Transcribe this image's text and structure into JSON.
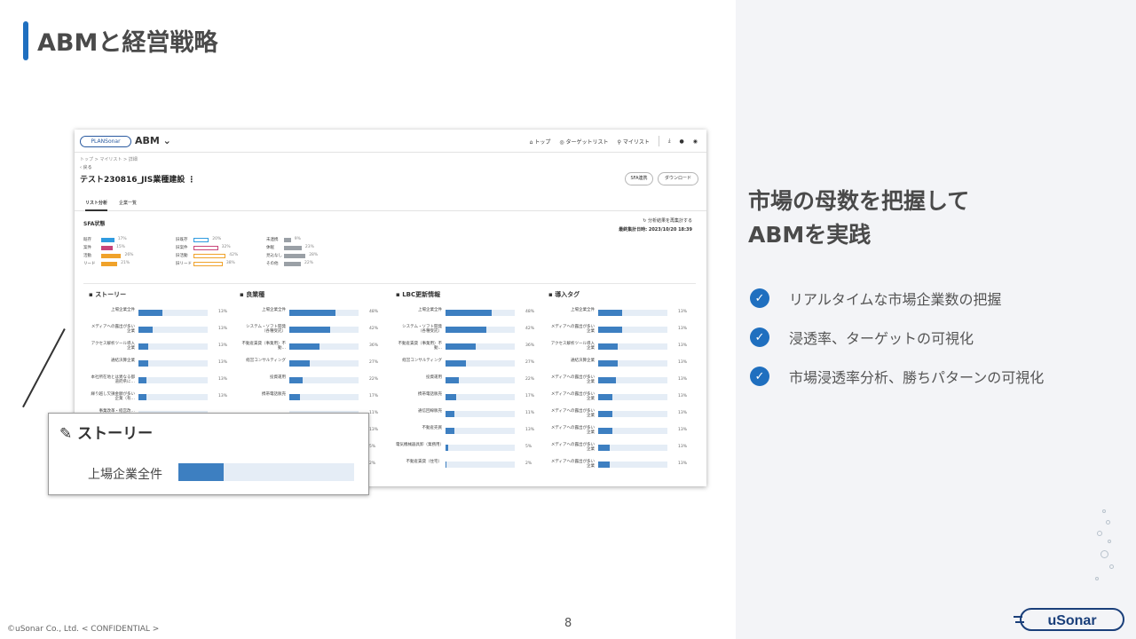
{
  "slide": {
    "title": "ABMと経営戦略",
    "page_number": "8",
    "copyright": "©uSonar Co., Ltd. < CONFIDENTIAL >"
  },
  "right_panel": {
    "headline_line1": "市場の母数を把握して",
    "headline_line2": "ABMを実践",
    "checks": [
      "リアルタイムな市場企業数の把握",
      "浸透率、ターゲットの可視化",
      "市場浸透率分析、勝ちパターンの可視化"
    ],
    "logo_text": "uSonar"
  },
  "app": {
    "logo_text": "PLANSonar",
    "name": "ABM ⌄",
    "nav": {
      "top": "トップ",
      "target_list": "ターゲットリスト",
      "my_list": "マイリスト"
    },
    "breadcrumb": "トップ  >  マイリスト  >  詳細",
    "back": "‹ 戻る",
    "list_title": "テスト230816_JIS業種建設  ⋮",
    "sfa_button": "SFA連携",
    "download_button": "ダウンロード",
    "tabs": [
      "リスト分析",
      "企業一覧"
    ],
    "sfa_section_title": "SFA状態",
    "reanalyze": "分析結果を再集計する",
    "last_updated": "最終集計日時: 2023/10/20 18:39"
  },
  "sfa_status": [
    {
      "label": "既存",
      "pct": "17%",
      "color": "#2f9be0"
    },
    {
      "label": "案件",
      "pct": "15%",
      "color": "#c8457a"
    },
    {
      "label": "活動",
      "pct": "26%",
      "color": "#f0a22a"
    },
    {
      "label": "リード",
      "pct": "21%",
      "color": "#f0a22a"
    },
    {
      "label": "旧既存",
      "pct": "20%",
      "color": "#2f9be0"
    },
    {
      "label": "旧案件",
      "pct": "32%",
      "color": "#c8457a"
    },
    {
      "label": "旧活動",
      "pct": "42%",
      "color": "#f0a22a"
    },
    {
      "label": "旧リード",
      "pct": "38%",
      "color": "#f0a22a"
    },
    {
      "label": "未連携",
      "pct": "9%",
      "color": "#9aa0a6"
    },
    {
      "label": "休眠",
      "pct": "23%",
      "color": "#9aa0a6"
    },
    {
      "label": "見込なし",
      "pct": "28%",
      "color": "#9aa0a6"
    },
    {
      "label": "その他",
      "pct": "22%",
      "color": "#9aa0a6"
    }
  ],
  "panels": [
    {
      "title": "ストーリー",
      "rows": [
        {
          "label": "上場企業全件",
          "pct": "13%",
          "value": 0.25
        },
        {
          "label": "メディアへの露出が多い企業",
          "pct": "13%",
          "value": 0.15
        },
        {
          "label": "アクセス解析ツール導入企業",
          "pct": "13%",
          "value": 0.1
        },
        {
          "label": "通結決算企業",
          "pct": "13%",
          "value": 0.1
        },
        {
          "label": "本社所在地とは異なる都道府県に…",
          "pct": "13%",
          "value": 0.08
        },
        {
          "label": "繰り越し欠損金額が多い企業（有…",
          "pct": "13%",
          "value": 0.08
        },
        {
          "label": "事業改革・経営改…",
          "pct": "",
          "value": 0.0
        }
      ]
    },
    {
      "title": "良業種",
      "rows": [
        {
          "label": "上場企業全件",
          "pct": "48%",
          "value": 0.48
        },
        {
          "label": "システム・ソフト開発（各種受託）",
          "pct": "42%",
          "value": 0.42
        },
        {
          "label": "不動産賃貸（事業用）不動…",
          "pct": "36%",
          "value": 0.31
        },
        {
          "label": "経営コンサルティング",
          "pct": "27%",
          "value": 0.21
        },
        {
          "label": "投資運用",
          "pct": "22%",
          "value": 0.14
        },
        {
          "label": "携帯電話販売",
          "pct": "17%",
          "value": 0.11
        },
        {
          "label": "",
          "pct": "11%",
          "value": 0.0
        },
        {
          "label": "",
          "pct": "13%",
          "value": 0.0
        },
        {
          "label": "",
          "pct": "5%",
          "value": 0.0
        },
        {
          "label": "",
          "pct": "2%",
          "value": 0.0
        }
      ]
    },
    {
      "title": "LBC更新情報",
      "rows": [
        {
          "label": "上場企業全件",
          "pct": "48%",
          "value": 0.48
        },
        {
          "label": "システム・ソフト開発（各種受託）",
          "pct": "42%",
          "value": 0.42
        },
        {
          "label": "不動産賃貸（事業用）不動…",
          "pct": "36%",
          "value": 0.31
        },
        {
          "label": "経営コンサルティング",
          "pct": "27%",
          "value": 0.21
        },
        {
          "label": "投資運用",
          "pct": "22%",
          "value": 0.14
        },
        {
          "label": "携帯電話販売",
          "pct": "17%",
          "value": 0.11
        },
        {
          "label": "通信回線販売",
          "pct": "11%",
          "value": 0.09
        },
        {
          "label": "不動産売買",
          "pct": "13%",
          "value": 0.09
        },
        {
          "label": "電気機械器具卸（業務用）",
          "pct": "5%",
          "value": 0.03
        },
        {
          "label": "不動産賃貸（住宅）",
          "pct": "2%",
          "value": 0.01
        }
      ]
    },
    {
      "title": "導入タグ",
      "rows": [
        {
          "label": "上場企業全件",
          "pct": "13%",
          "value": 0.25
        },
        {
          "label": "メディアへの露出が多い企業",
          "pct": "13%",
          "value": 0.25
        },
        {
          "label": "アクセス解析ツール導入企業",
          "pct": "13%",
          "value": 0.2
        },
        {
          "label": "通結決算企業",
          "pct": "13%",
          "value": 0.2
        },
        {
          "label": "メディアへの露出が多い企業",
          "pct": "13%",
          "value": 0.18
        },
        {
          "label": "メディアへの露出が多い企業",
          "pct": "13%",
          "value": 0.15
        },
        {
          "label": "メディアへの露出が多い企業",
          "pct": "13%",
          "value": 0.15
        },
        {
          "label": "メディアへの露出が多い企業",
          "pct": "13%",
          "value": 0.15
        },
        {
          "label": "メディアへの露出が多い企業",
          "pct": "13%",
          "value": 0.12
        },
        {
          "label": "メディアへの露出が多い企業",
          "pct": "13%",
          "value": 0.12
        }
      ]
    }
  ],
  "zoom": {
    "title": "ストーリー",
    "row_label": "上場企業全件",
    "value": 0.26
  }
}
